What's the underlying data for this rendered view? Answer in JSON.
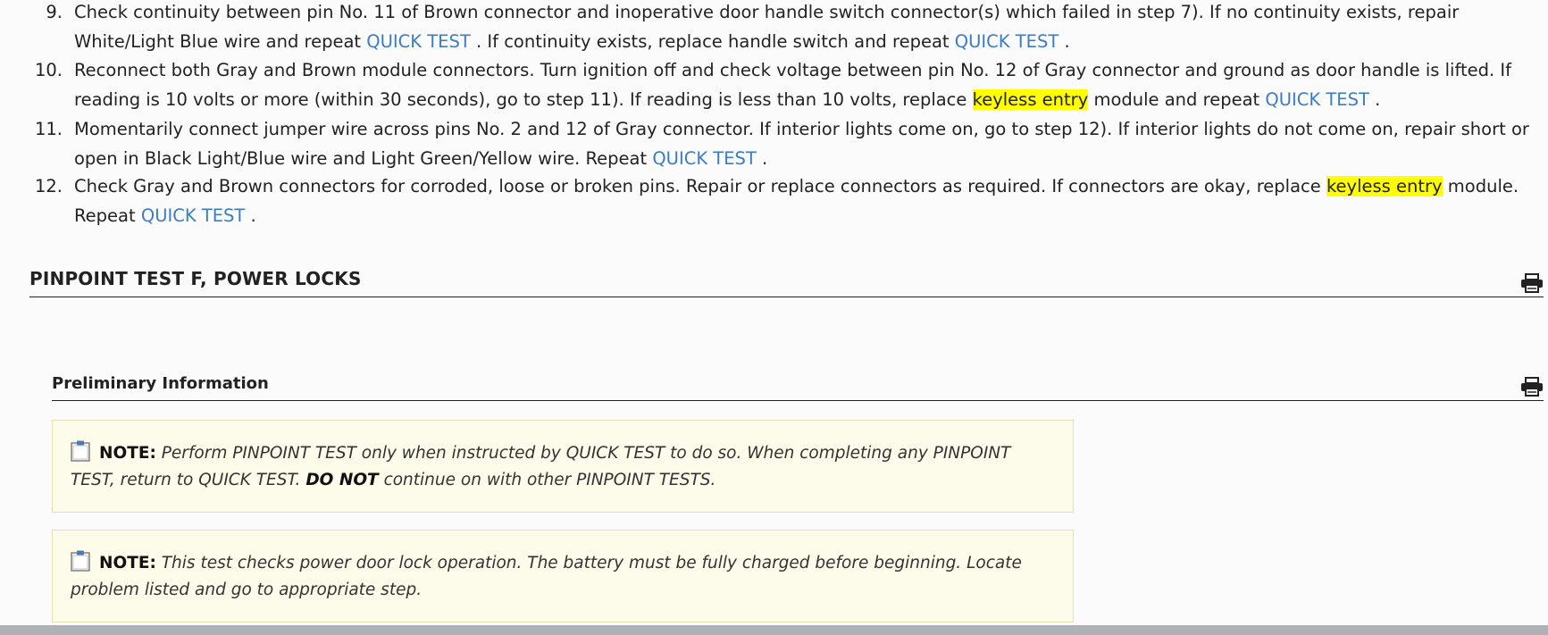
{
  "steps": [
    {
      "num": "9.",
      "parts": [
        {
          "t": "Check continuity between pin No. 11 of Brown connector and inoperative door handle switch connector(s) which failed in step 7). If no continuity exists, repair White/Light Blue wire and repeat "
        },
        {
          "t": "QUICK TEST",
          "link": true
        },
        {
          "t": " . If continuity exists, replace handle switch and repeat "
        },
        {
          "t": "QUICK TEST",
          "link": true
        },
        {
          "t": " ."
        }
      ]
    },
    {
      "num": "10.",
      "parts": [
        {
          "t": "Reconnect both Gray and Brown module connectors. Turn ignition off and check voltage between pin No. 12 of Gray connector and ground as door handle is lifted. If reading is 10 volts or more (within 30 seconds), go to step 11). If reading is less than 10 volts, replace "
        },
        {
          "t": "keyless entry",
          "hl": true
        },
        {
          "t": " module and repeat "
        },
        {
          "t": "QUICK TEST",
          "link": true
        },
        {
          "t": " ."
        }
      ]
    },
    {
      "num": "11.",
      "parts": [
        {
          "t": "Momentarily connect jumper wire across pins No. 2 and 12 of Gray connector. If interior lights come on, go to step 12). If interior lights do not come on, repair short or open in Black Light/Blue wire and Light Green/Yellow wire. Repeat "
        },
        {
          "t": "QUICK TEST",
          "link": true
        },
        {
          "t": " ."
        }
      ]
    },
    {
      "num": "12.",
      "parts": [
        {
          "t": "Check Gray and Brown connectors for corroded, loose or broken pins. Repair or replace connectors as required. If connectors are okay, replace "
        },
        {
          "t": "keyless entry",
          "hl": true
        },
        {
          "t": " module. Repeat "
        },
        {
          "t": "QUICK TEST",
          "link": true
        },
        {
          "t": " ."
        }
      ]
    }
  ],
  "section": {
    "title": "PINPOINT TEST F, POWER LOCKS",
    "print_icon": "printer-icon"
  },
  "subsection": {
    "title": "Preliminary Information",
    "print_icon": "printer-icon"
  },
  "notes": [
    {
      "label": "NOTE:",
      "icon": "note-icon",
      "text_before": " Perform PINPOINT TEST only when instructed by QUICK TEST to do so. When completing any PINPOINT TEST, return to QUICK TEST. ",
      "strong": "DO NOT",
      "text_after": "  continue on with other PINPOINT TESTS."
    },
    {
      "label": "NOTE:",
      "icon": "note-icon",
      "text_before": " This test checks power door lock operation. The battery must be fully charged before beginning. Locate problem listed and go to appropriate step.",
      "strong": "",
      "text_after": ""
    }
  ],
  "colors": {
    "link": "#3b7cc4",
    "highlight": "#ffff00",
    "note_bg": "#fdfbe9"
  }
}
